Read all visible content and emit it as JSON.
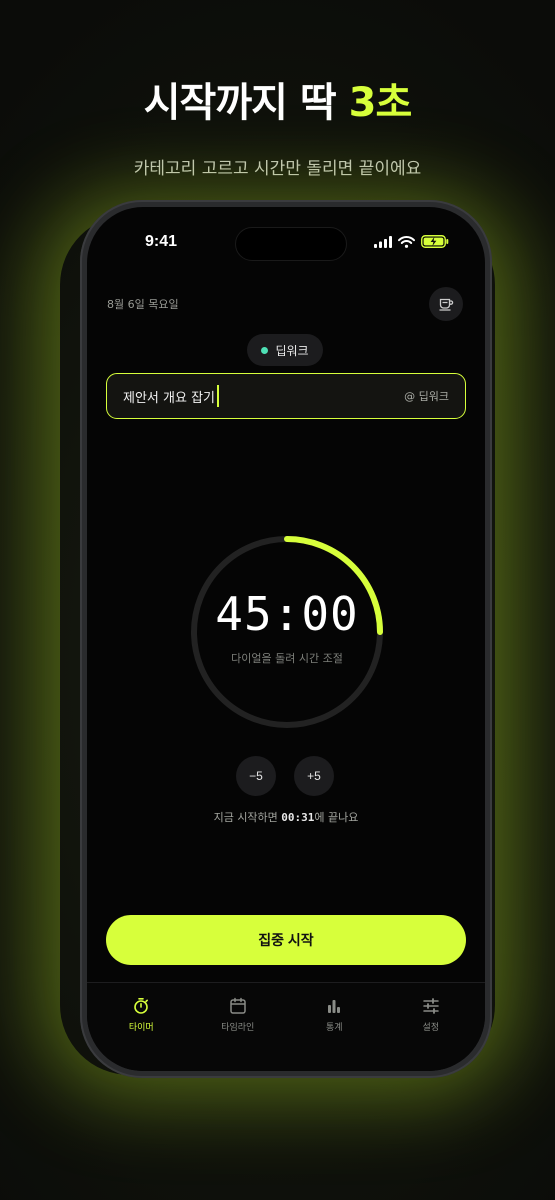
{
  "hero": {
    "title_main": "시작까지 딱 ",
    "title_accent": "3초",
    "subtitle": "카테고리 고르고 시간만 돌리면 끝이에요"
  },
  "status_bar": {
    "time": "9:41"
  },
  "header": {
    "date": "8월 6일 목요일",
    "coffee_icon": "coffee-cup-icon"
  },
  "category_chip": {
    "label": "딥워크",
    "dot_color": "#4ee0b5"
  },
  "task_input": {
    "value": "제안서 개요 잡기",
    "category_tag": "@ 딥워크"
  },
  "timer": {
    "display": "45:00",
    "hint": "다이얼을 돌려 시간 조절",
    "progress": 0.25,
    "accent_color": "#d7ff3b"
  },
  "adjust": {
    "minus_label": "−5",
    "plus_label": "+5"
  },
  "end_time": {
    "prefix": "지금 시작하면 ",
    "time": "00:31",
    "suffix": "에 끝나요"
  },
  "start_button": {
    "label": "집중 시작"
  },
  "tabs": [
    {
      "label": "타이머",
      "icon": "stopwatch-icon",
      "active": true
    },
    {
      "label": "타임라인",
      "icon": "calendar-icon",
      "active": false
    },
    {
      "label": "통계",
      "icon": "bar-chart-icon",
      "active": false
    },
    {
      "label": "설정",
      "icon": "sliders-icon",
      "active": false
    }
  ]
}
